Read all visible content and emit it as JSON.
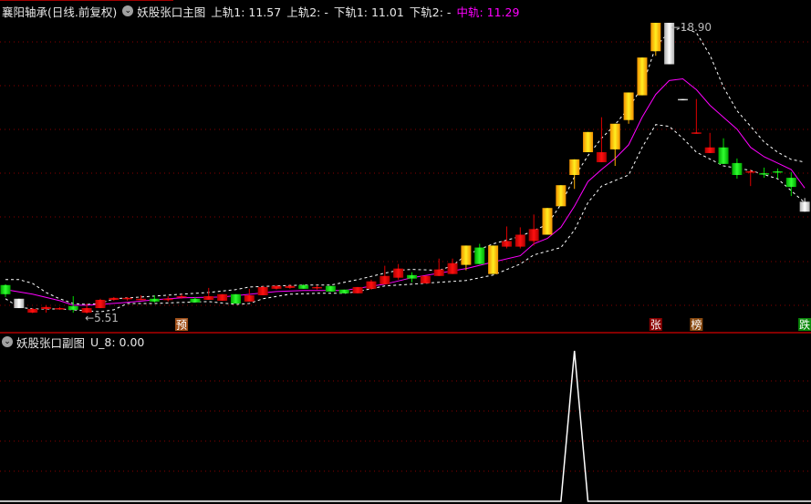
{
  "header": {
    "stock": "襄阳轴承(日线.前复权)",
    "indicator": "妖股张口主图",
    "upper1": "上轨1: 11.57",
    "upper2": "上轨2: -",
    "lower1": "下轨1: 11.01",
    "lower2": "下轨2: -",
    "middle": "中轨: 11.29"
  },
  "sub_header": {
    "indicator": "妖股张口副图",
    "value": "U_8: 0.00"
  },
  "annotations": {
    "high_label": "←18.90",
    "low_label": "←5.51"
  },
  "markers": [
    {
      "index": 13,
      "text": "预",
      "color": "#a0501a"
    },
    {
      "index": 48,
      "text": "张",
      "color": "#8a0000"
    },
    {
      "index": 51,
      "text": "榜",
      "color": "#8a4a10"
    },
    {
      "index": 59,
      "text": "跌",
      "color": "#0a8a0a"
    }
  ],
  "colors": {
    "up": "#e00000",
    "down": "#00dd00",
    "limit_up": "#ffb000",
    "special": "#e0e0e0",
    "middle_line": "#ff00ff",
    "band_line": "#ffffff",
    "grid": "#8a0000"
  },
  "chart_data": [
    {
      "type": "candlestick",
      "title": "妖股张口主图",
      "ylim": [
        5.51,
        18.9
      ],
      "grid": true,
      "candles": [
        {
          "o": 6.82,
          "h": 6.86,
          "l": 6.27,
          "c": 6.4,
          "s": "down"
        },
        {
          "o": 6.19,
          "h": 6.19,
          "l": 5.76,
          "c": 5.76,
          "s": "special"
        },
        {
          "o": 5.55,
          "h": 5.76,
          "l": 5.53,
          "c": 5.72,
          "s": "up"
        },
        {
          "o": 5.72,
          "h": 5.89,
          "l": 5.55,
          "c": 5.81,
          "s": "up"
        },
        {
          "o": 5.73,
          "h": 5.81,
          "l": 5.68,
          "c": 5.76,
          "s": "up"
        },
        {
          "o": 5.85,
          "h": 6.31,
          "l": 5.55,
          "c": 5.68,
          "s": "down"
        },
        {
          "o": 5.55,
          "h": 5.97,
          "l": 5.51,
          "c": 5.76,
          "s": "up"
        },
        {
          "o": 5.76,
          "h": 6.19,
          "l": 5.76,
          "c": 6.14,
          "s": "up"
        },
        {
          "o": 6.14,
          "h": 6.27,
          "l": 6.1,
          "c": 6.23,
          "s": "up"
        },
        {
          "o": 6.19,
          "h": 6.27,
          "l": 6.1,
          "c": 6.23,
          "s": "up"
        },
        {
          "o": 6.14,
          "h": 6.35,
          "l": 6.14,
          "c": 6.19,
          "s": "up"
        },
        {
          "o": 6.19,
          "h": 6.35,
          "l": 6.02,
          "c": 6.06,
          "s": "down"
        },
        {
          "o": 6.14,
          "h": 6.31,
          "l": 6.06,
          "c": 6.19,
          "s": "up"
        },
        {
          "o": 6.27,
          "h": 6.4,
          "l": 6.19,
          "c": 6.31,
          "s": "up"
        },
        {
          "o": 6.19,
          "h": 6.27,
          "l": 6.02,
          "c": 6.02,
          "s": "down"
        },
        {
          "o": 6.14,
          "h": 6.69,
          "l": 6.14,
          "c": 6.31,
          "s": "up"
        },
        {
          "o": 6.1,
          "h": 6.4,
          "l": 6.1,
          "c": 6.4,
          "s": "up"
        },
        {
          "o": 6.4,
          "h": 6.4,
          "l": 5.97,
          "c": 5.97,
          "s": "down"
        },
        {
          "o": 6.06,
          "h": 6.65,
          "l": 6.06,
          "c": 6.35,
          "s": "up"
        },
        {
          "o": 6.35,
          "h": 6.78,
          "l": 6.35,
          "c": 6.73,
          "s": "up"
        },
        {
          "o": 6.65,
          "h": 6.82,
          "l": 6.61,
          "c": 6.78,
          "s": "up"
        },
        {
          "o": 6.69,
          "h": 6.86,
          "l": 6.65,
          "c": 6.78,
          "s": "up"
        },
        {
          "o": 6.82,
          "h": 6.86,
          "l": 6.65,
          "c": 6.65,
          "s": "down"
        },
        {
          "o": 6.69,
          "h": 6.82,
          "l": 6.61,
          "c": 6.73,
          "s": "up"
        },
        {
          "o": 6.78,
          "h": 6.78,
          "l": 6.52,
          "c": 6.52,
          "s": "down"
        },
        {
          "o": 6.61,
          "h": 6.61,
          "l": 6.44,
          "c": 6.44,
          "s": "down"
        },
        {
          "o": 6.44,
          "h": 6.73,
          "l": 6.44,
          "c": 6.73,
          "s": "up"
        },
        {
          "o": 6.65,
          "h": 7.07,
          "l": 6.61,
          "c": 6.99,
          "s": "up"
        },
        {
          "o": 6.86,
          "h": 7.71,
          "l": 6.86,
          "c": 7.24,
          "s": "up"
        },
        {
          "o": 7.16,
          "h": 7.79,
          "l": 7.07,
          "c": 7.58,
          "s": "up"
        },
        {
          "o": 7.28,
          "h": 7.41,
          "l": 6.95,
          "c": 7.12,
          "s": "down"
        },
        {
          "o": 6.9,
          "h": 7.24,
          "l": 6.9,
          "c": 7.24,
          "s": "up"
        },
        {
          "o": 7.24,
          "h": 8.04,
          "l": 7.24,
          "c": 7.54,
          "s": "up"
        },
        {
          "o": 7.33,
          "h": 8.04,
          "l": 7.33,
          "c": 7.83,
          "s": "up"
        },
        {
          "o": 7.75,
          "h": 8.64,
          "l": 7.5,
          "c": 8.64,
          "s": "limit_up"
        },
        {
          "o": 8.55,
          "h": 8.72,
          "l": 7.79,
          "c": 7.79,
          "s": "down"
        },
        {
          "o": 7.33,
          "h": 8.64,
          "l": 7.33,
          "c": 8.64,
          "s": "limit_up"
        },
        {
          "o": 8.59,
          "h": 9.52,
          "l": 8.51,
          "c": 8.85,
          "s": "up"
        },
        {
          "o": 8.59,
          "h": 9.48,
          "l": 8.51,
          "c": 9.14,
          "s": "up"
        },
        {
          "o": 8.85,
          "h": 10.07,
          "l": 8.64,
          "c": 9.4,
          "s": "up"
        },
        {
          "o": 9.14,
          "h": 10.37,
          "l": 9.14,
          "c": 10.37,
          "s": "limit_up"
        },
        {
          "o": 10.45,
          "h": 11.42,
          "l": 10.45,
          "c": 11.42,
          "s": "limit_up"
        },
        {
          "o": 11.89,
          "h": 12.61,
          "l": 11.25,
          "c": 12.61,
          "s": "limit_up"
        },
        {
          "o": 12.94,
          "h": 13.87,
          "l": 12.94,
          "c": 13.87,
          "s": "limit_up"
        },
        {
          "o": 12.48,
          "h": 14.55,
          "l": 12.48,
          "c": 12.94,
          "s": "up"
        },
        {
          "o": 13.07,
          "h": 14.25,
          "l": 12.31,
          "c": 14.25,
          "s": "limit_up"
        },
        {
          "o": 14.42,
          "h": 15.69,
          "l": 14.25,
          "c": 15.69,
          "s": "limit_up"
        },
        {
          "o": 15.56,
          "h": 17.3,
          "l": 15.56,
          "c": 17.3,
          "s": "limit_up"
        },
        {
          "o": 17.59,
          "h": 18.9,
          "l": 17.38,
          "c": 18.9,
          "s": "limit_up"
        },
        {
          "o": 18.9,
          "h": 18.9,
          "l": 16.99,
          "c": 16.99,
          "s": "special"
        },
        {
          "o": 15.39,
          "h": 15.39,
          "l": 15.39,
          "c": 15.39,
          "s": "special"
        },
        {
          "o": 13.83,
          "h": 15.39,
          "l": 13.83,
          "c": 13.85,
          "s": "up"
        },
        {
          "o": 12.9,
          "h": 13.83,
          "l": 12.9,
          "c": 13.16,
          "s": "up"
        },
        {
          "o": 13.16,
          "h": 13.58,
          "l": 12.4,
          "c": 12.4,
          "s": "down"
        },
        {
          "o": 12.44,
          "h": 12.65,
          "l": 11.72,
          "c": 11.89,
          "s": "down"
        },
        {
          "o": 12.02,
          "h": 12.14,
          "l": 11.38,
          "c": 12.06,
          "s": "up"
        },
        {
          "o": 11.97,
          "h": 12.23,
          "l": 11.76,
          "c": 11.93,
          "s": "down"
        },
        {
          "o": 12.06,
          "h": 12.19,
          "l": 11.72,
          "c": 12.02,
          "s": "down"
        },
        {
          "o": 11.76,
          "h": 12.02,
          "l": 10.92,
          "c": 11.34,
          "s": "down"
        },
        {
          "o": 10.66,
          "h": 10.83,
          "l": 10.2,
          "c": 10.2,
          "s": "special"
        }
      ],
      "lines": {
        "upper": [
          [
            0,
            7.07
          ],
          [
            1,
            7.07
          ],
          [
            2,
            6.9
          ],
          [
            3,
            6.48
          ],
          [
            4,
            6.19
          ],
          [
            5,
            5.97
          ],
          [
            6,
            5.93
          ],
          [
            7,
            5.97
          ],
          [
            8,
            6.19
          ],
          [
            10,
            6.27
          ],
          [
            13,
            6.4
          ],
          [
            15,
            6.48
          ],
          [
            17,
            6.61
          ],
          [
            18,
            6.73
          ],
          [
            20,
            6.78
          ],
          [
            22,
            6.82
          ],
          [
            24,
            6.82
          ],
          [
            26,
            7.07
          ],
          [
            28,
            7.37
          ],
          [
            29,
            7.5
          ],
          [
            30,
            7.54
          ],
          [
            32,
            7.5
          ],
          [
            33,
            7.71
          ],
          [
            34,
            8.21
          ],
          [
            36,
            8.72
          ],
          [
            38,
            9.06
          ],
          [
            40,
            9.61
          ],
          [
            41,
            10.54
          ],
          [
            42,
            11.8
          ],
          [
            43,
            12.78
          ],
          [
            44,
            13.58
          ],
          [
            45,
            14.21
          ],
          [
            46,
            14.97
          ],
          [
            47,
            15.94
          ],
          [
            48,
            17.8
          ],
          [
            49,
            18.48
          ],
          [
            50,
            18.69
          ],
          [
            51,
            18.44
          ],
          [
            52,
            17.42
          ],
          [
            53,
            15.94
          ],
          [
            54,
            14.85
          ],
          [
            55,
            14.13
          ],
          [
            56,
            13.41
          ],
          [
            57,
            12.94
          ],
          [
            58,
            12.61
          ],
          [
            59,
            12.48
          ]
        ],
        "middle": [
          [
            0,
            6.61
          ],
          [
            2,
            6.4
          ],
          [
            4,
            6.1
          ],
          [
            5,
            5.89
          ],
          [
            6,
            5.89
          ],
          [
            7,
            5.93
          ],
          [
            9,
            6.02
          ],
          [
            11,
            6.14
          ],
          [
            13,
            6.23
          ],
          [
            16,
            6.27
          ],
          [
            20,
            6.52
          ],
          [
            22,
            6.57
          ],
          [
            25,
            6.57
          ],
          [
            28,
            6.86
          ],
          [
            30,
            7.16
          ],
          [
            32,
            7.37
          ],
          [
            34,
            7.58
          ],
          [
            36,
            7.88
          ],
          [
            38,
            8.17
          ],
          [
            39,
            8.72
          ],
          [
            40,
            8.97
          ],
          [
            41,
            9.48
          ],
          [
            42,
            10.45
          ],
          [
            43,
            11.59
          ],
          [
            44,
            12.14
          ],
          [
            45,
            12.65
          ],
          [
            46,
            13.28
          ],
          [
            47,
            14.55
          ],
          [
            48,
            15.6
          ],
          [
            49,
            16.24
          ],
          [
            50,
            16.32
          ],
          [
            51,
            15.82
          ],
          [
            52,
            15.1
          ],
          [
            53,
            14.55
          ],
          [
            54,
            14.0
          ],
          [
            55,
            13.16
          ],
          [
            56,
            12.73
          ],
          [
            57,
            12.44
          ],
          [
            58,
            12.14
          ],
          [
            59,
            11.29
          ]
        ],
        "lower": [
          [
            0,
            6.19
          ],
          [
            1,
            5.81
          ],
          [
            2,
            5.72
          ],
          [
            4,
            5.72
          ],
          [
            5,
            5.68
          ],
          [
            7,
            5.59
          ],
          [
            8,
            5.68
          ],
          [
            9,
            5.97
          ],
          [
            11,
            5.97
          ],
          [
            13,
            6.02
          ],
          [
            15,
            6.06
          ],
          [
            17,
            5.93
          ],
          [
            18,
            5.97
          ],
          [
            19,
            6.19
          ],
          [
            21,
            6.4
          ],
          [
            23,
            6.44
          ],
          [
            25,
            6.44
          ],
          [
            26,
            6.52
          ],
          [
            28,
            6.78
          ],
          [
            30,
            6.86
          ],
          [
            32,
            6.95
          ],
          [
            34,
            7.03
          ],
          [
            36,
            7.28
          ],
          [
            38,
            7.79
          ],
          [
            39,
            8.21
          ],
          [
            41,
            8.55
          ],
          [
            42,
            9.35
          ],
          [
            43,
            10.62
          ],
          [
            44,
            11.38
          ],
          [
            46,
            11.89
          ],
          [
            47,
            13.16
          ],
          [
            48,
            14.21
          ],
          [
            49,
            14.13
          ],
          [
            50,
            13.58
          ],
          [
            51,
            12.94
          ],
          [
            53,
            12.31
          ],
          [
            55,
            12.1
          ],
          [
            57,
            11.72
          ],
          [
            59,
            10.62
          ]
        ]
      }
    },
    {
      "type": "line",
      "title": "妖股张口副图",
      "series": [
        {
          "name": "U_8",
          "values_nonzero": [
            [
              42,
              1.0
            ]
          ]
        }
      ],
      "count": 60,
      "ylim": [
        0,
        1
      ],
      "grid": true
    }
  ]
}
